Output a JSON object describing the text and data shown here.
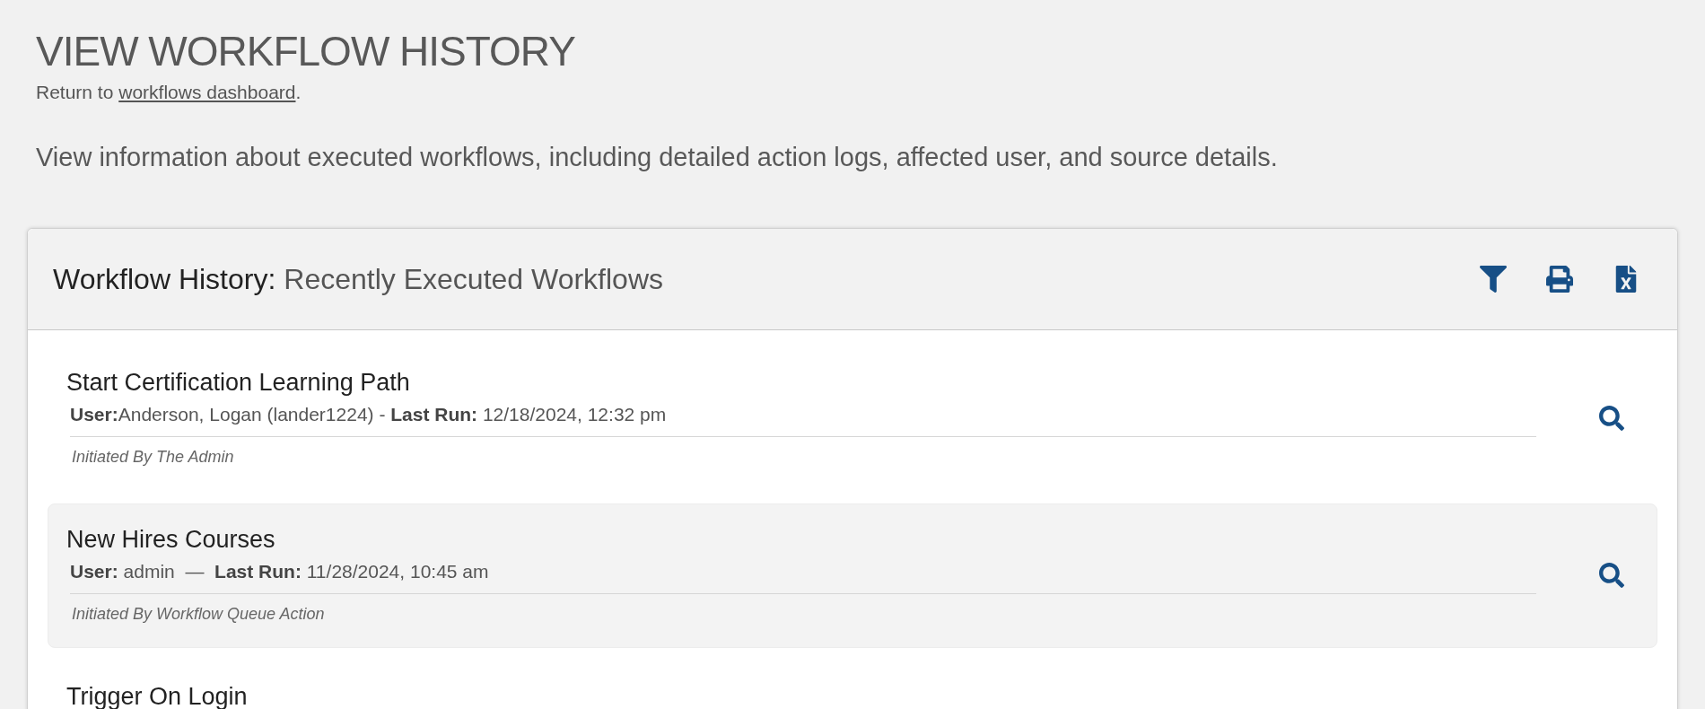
{
  "page_title": "VIEW WORKFLOW HISTORY",
  "return_line": {
    "before": "Return to ",
    "link": "workflows dashboard",
    "after": "."
  },
  "description": "View information about executed workflows, including detailed action logs, affected user, and source details.",
  "panel": {
    "title_prefix": "Workflow History:",
    "title": "Recently Executed Workflows",
    "actions": [
      {
        "kind": "filter"
      },
      {
        "kind": "print"
      },
      {
        "kind": "excel"
      }
    ],
    "items": [
      {
        "name": "Start Certification Learning Path",
        "meta": "**User:**Anderson, Logan (lander1224) - **Last Run:** 12/18/2024, 12:32 pm",
        "initiated": "Initiated By The Admin",
        "selected": false
      },
      {
        "name": "New Hires Courses",
        "meta": "**User:** admin  —  **Last Run:** 11/28/2024, 10:45 am",
        "initiated": "Initiated By Workflow Queue Action",
        "selected": true
      },
      {
        "name": "Trigger On Login",
        "selected": false
      }
    ]
  }
}
